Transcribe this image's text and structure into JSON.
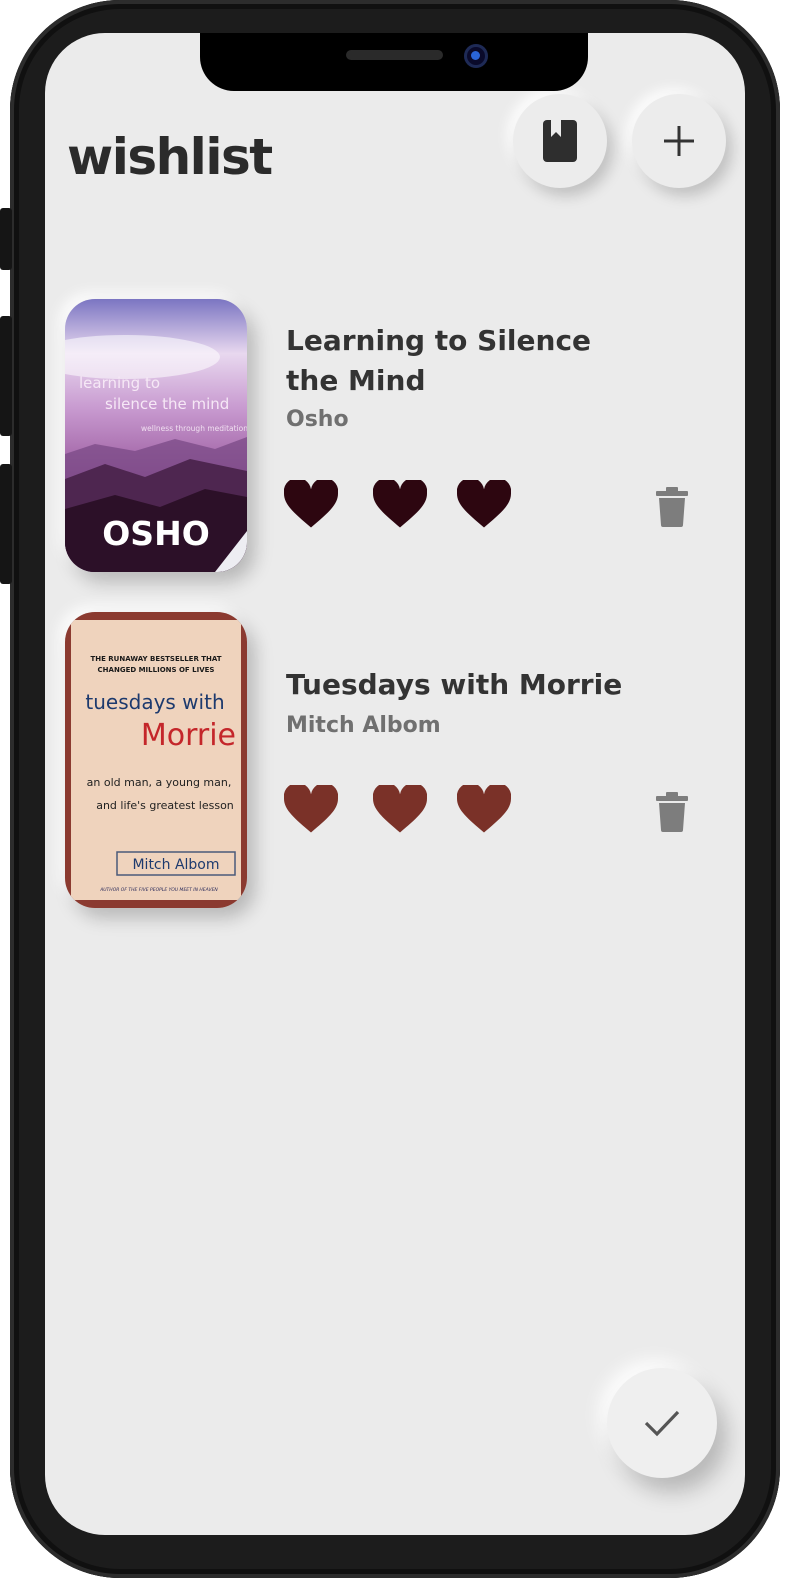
{
  "header": {
    "title": "wishlist",
    "library_button_icon": "book-icon",
    "add_button_icon": "plus-icon"
  },
  "books": [
    {
      "title": "Learning to Silence the Mind",
      "author": "Osho",
      "rating_hearts": 3,
      "heart_color": "#2d0610",
      "cover": {
        "title_line1": "learning to",
        "title_line2": "silence the mind",
        "subtitle": "wellness through meditation",
        "author": "OSHO"
      }
    },
    {
      "title": "Tuesdays with Morrie",
      "author": "Mitch Albom",
      "rating_hearts": 3,
      "heart_color": "#7a3128",
      "cover": {
        "tagline_line1": "THE RUNAWAY BESTSELLER THAT",
        "tagline_line2": "CHANGED MILLIONS OF LIVES",
        "title_line1": "tuesdays with",
        "title_line2": "Morrie",
        "subtitle_line1": "an old man, a young man,",
        "subtitle_line2": "and life's greatest lesson",
        "author": "Mitch Albom",
        "footer": "AUTHOR OF THE FIVE PEOPLE YOU MEET IN HEAVEN"
      }
    }
  ],
  "fab_icon": "checkmark-icon",
  "colors": {
    "background": "#ebebeb",
    "title_text": "#2b2b2b",
    "author_text": "#707070",
    "icon_gray": "#7d7d7d"
  }
}
